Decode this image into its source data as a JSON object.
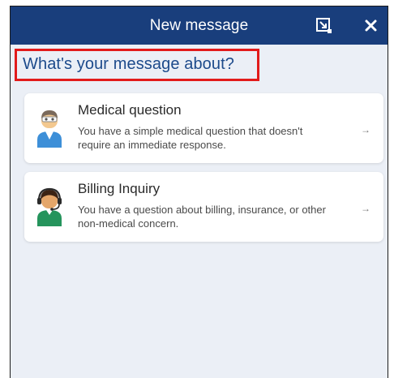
{
  "window": {
    "title": "New message",
    "popout_icon": "popout-icon",
    "close_icon": "close-icon"
  },
  "main": {
    "heading": "What's your message about?",
    "options": [
      {
        "title": "Medical question",
        "description": "You have a simple medical question that doesn't require an immediate response.",
        "icon": "doctor-icon",
        "arrow": "→"
      },
      {
        "title": "Billing Inquiry",
        "description": "You have a question about billing, insurance, or other non-medical concern.",
        "icon": "billing-agent-headset-icon",
        "arrow": "→"
      }
    ]
  },
  "colors": {
    "titlebar": "#193e7c",
    "background": "#ebeff6",
    "heading": "#1c4a8b",
    "highlight_border": "#e21b1b"
  }
}
